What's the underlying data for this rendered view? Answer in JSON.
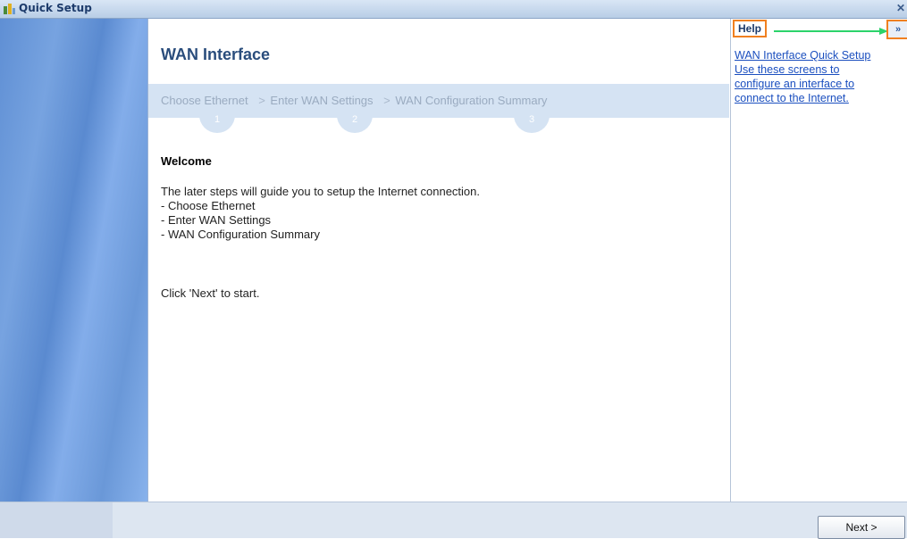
{
  "window": {
    "title": "Quick Setup",
    "close_glyph": "✕"
  },
  "main": {
    "title": "WAN Interface",
    "steps": [
      {
        "label": "Choose Ethernet",
        "number": "1"
      },
      {
        "label": "Enter WAN Settings",
        "number": "2"
      },
      {
        "label": "WAN Configuration Summary",
        "number": "3"
      }
    ],
    "step_separator": ">",
    "welcome_heading": "Welcome",
    "intro": "The later steps will guide you to setup the Internet connection.",
    "list": [
      "- Choose Ethernet",
      "- Enter WAN Settings",
      "- WAN Configuration Summary"
    ],
    "start_text": "Click 'Next' to start."
  },
  "help": {
    "label": "Help",
    "collapse_glyph": "»",
    "links": [
      "WAN Interface Quick Setup",
      "Use these screens to",
      "configure an interface to",
      "connect to the Internet."
    ]
  },
  "footer": {
    "next_label": "Next >"
  },
  "colors": {
    "accent_orange": "#f08020",
    "arrow_green": "#2bd36a",
    "title_blue": "#2a4d7c",
    "link_blue": "#1b4fbf"
  },
  "icons": {
    "app": "quick-setup-icon",
    "close": "close-icon",
    "collapse": "double-chevron-right-icon",
    "arrow": "arrow-right-icon"
  }
}
